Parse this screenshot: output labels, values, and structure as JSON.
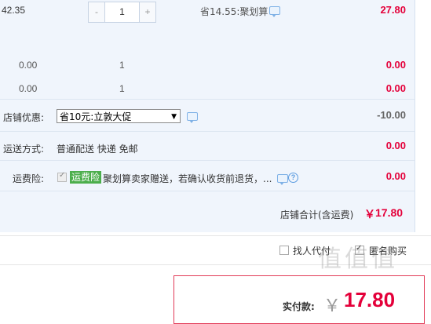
{
  "item_row": {
    "unit_price": "42.35",
    "qty_minus": "-",
    "qty_value": "1",
    "qty_plus": "+",
    "saving_text": "省14.55:聚划算",
    "subtotal": "27.80"
  },
  "extra_rows": [
    {
      "price": "0.00",
      "qty": "1",
      "subtotal": "0.00"
    },
    {
      "price": "0.00",
      "qty": "1",
      "subtotal": "0.00"
    }
  ],
  "shop_discount": {
    "label": "店铺优惠:",
    "selected_option": "省10元:立敦大促",
    "amount": "-10.00"
  },
  "shipping": {
    "label": "运送方式:",
    "value": "普通配送 快递 免邮",
    "amount": "0.00"
  },
  "insurance": {
    "label": "运费险:",
    "tag": "运费险",
    "text": "聚划算卖家赠送，若确认收货前退货，...",
    "amount": "0.00"
  },
  "shop_total": {
    "label": "店铺合计(含运费)",
    "currency": "￥",
    "value": "17.80"
  },
  "options": {
    "proxy_pay": "找人代付",
    "anonymous": "匿名购买"
  },
  "payment": {
    "label": "实付款:",
    "currency": "￥",
    "value": "17.80"
  },
  "watermark": "值值值"
}
